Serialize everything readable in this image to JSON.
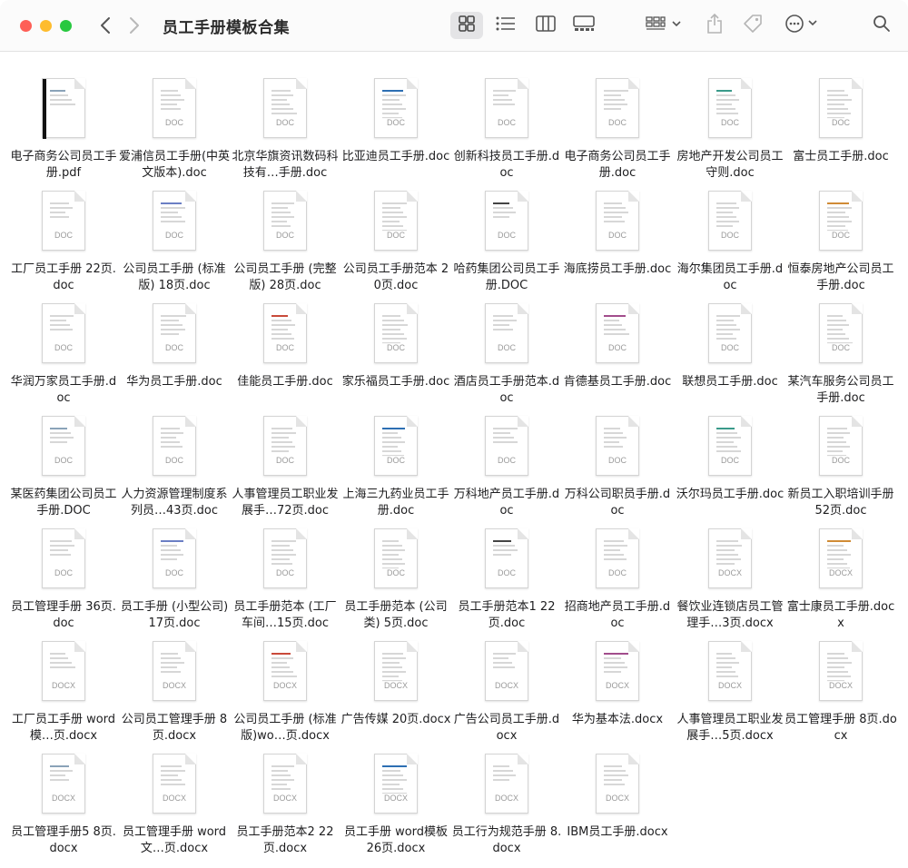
{
  "window": {
    "title": "员工手册模板合集"
  },
  "toolbar": {
    "back_icon": "chevron-left-icon",
    "forward_icon": "chevron-right-icon",
    "view_icons": "icon-grid, list, columns, gallery",
    "group_icon": "group-by-icon",
    "share_icon": "share-icon",
    "tag_icon": "tag-icon",
    "more_icon": "ellipsis-circle-icon",
    "search_icon": "search-icon"
  },
  "files": [
    {
      "name": "电子商务公司员工手册.pdf",
      "type": "pdf",
      "label": ""
    },
    {
      "name": "爱浦信员工手册(中英文版本).doc",
      "type": "doc",
      "label": "DOC"
    },
    {
      "name": "北京华旗资讯数码科技有…手册.doc",
      "type": "doc",
      "label": "DOC"
    },
    {
      "name": "比亚迪员工手册.doc",
      "type": "doc",
      "label": "DOC"
    },
    {
      "name": "创新科技员工手册.doc",
      "type": "doc",
      "label": "DOC"
    },
    {
      "name": "电子商务公司员工手册.doc",
      "type": "doc",
      "label": "DOC"
    },
    {
      "name": "房地产开发公司员工守则.doc",
      "type": "doc",
      "label": "DOC"
    },
    {
      "name": "富士员工手册.doc",
      "type": "doc",
      "label": "DOC"
    },
    {
      "name": "工厂员工手册 22页.doc",
      "type": "doc",
      "label": "DOC"
    },
    {
      "name": "公司员工手册 (标准版) 18页.doc",
      "type": "doc",
      "label": "DOC"
    },
    {
      "name": "公司员工手册 (完整版) 28页.doc",
      "type": "doc",
      "label": "DOC"
    },
    {
      "name": "公司员工手册范本 20页.doc",
      "type": "doc",
      "label": "DOC"
    },
    {
      "name": "哈药集团公司员工手册.DOC",
      "type": "doc",
      "label": "DOC"
    },
    {
      "name": "海底捞员工手册.doc",
      "type": "doc",
      "label": "DOC"
    },
    {
      "name": "海尔集团员工手册.doc",
      "type": "doc",
      "label": "DOC"
    },
    {
      "name": "恒泰房地产公司员工手册.doc",
      "type": "doc",
      "label": "DOC"
    },
    {
      "name": "华润万家员工手册.doc",
      "type": "doc",
      "label": "DOC"
    },
    {
      "name": "华为员工手册.doc",
      "type": "doc",
      "label": "DOC"
    },
    {
      "name": "佳能员工手册.doc",
      "type": "doc",
      "label": "DOC"
    },
    {
      "name": "家乐福员工手册.doc",
      "type": "doc",
      "label": "DOC"
    },
    {
      "name": "酒店员工手册范本.doc",
      "type": "doc",
      "label": "DOC"
    },
    {
      "name": "肯德基员工手册.doc",
      "type": "doc",
      "label": "DOC"
    },
    {
      "name": "联想员工手册.doc",
      "type": "doc",
      "label": "DOC"
    },
    {
      "name": "某汽车服务公司员工手册.doc",
      "type": "doc",
      "label": "DOC"
    },
    {
      "name": "某医药集团公司员工手册.DOC",
      "type": "doc",
      "label": "DOC"
    },
    {
      "name": "人力资源管理制度系列员…43页.doc",
      "type": "doc",
      "label": "DOC"
    },
    {
      "name": "人事管理员工职业发展手…72页.doc",
      "type": "doc",
      "label": "DOC"
    },
    {
      "name": "上海三九药业员工手册.doc",
      "type": "doc",
      "label": "DOC"
    },
    {
      "name": "万科地产员工手册.doc",
      "type": "doc",
      "label": "DOC"
    },
    {
      "name": "万科公司职员手册.doc",
      "type": "doc",
      "label": "DOC"
    },
    {
      "name": "沃尔玛员工手册.doc",
      "type": "doc",
      "label": "DOC"
    },
    {
      "name": "新员工入职培训手册 52页.doc",
      "type": "doc",
      "label": "DOC"
    },
    {
      "name": "员工管理手册  36页.doc",
      "type": "doc",
      "label": "DOC"
    },
    {
      "name": "员工手册 (小型公司) 17页.doc",
      "type": "doc",
      "label": "DOC"
    },
    {
      "name": "员工手册范本 (工厂车间…15页.doc",
      "type": "doc",
      "label": "DOC"
    },
    {
      "name": "员工手册范本 (公司类) 5页.doc",
      "type": "doc",
      "label": "DOC"
    },
    {
      "name": "员工手册范本1 22页.doc",
      "type": "doc",
      "label": "DOC"
    },
    {
      "name": "招商地产员工手册.doc",
      "type": "doc",
      "label": "DOC"
    },
    {
      "name": "餐饮业连锁店员工管理手…3页.docx",
      "type": "docx",
      "label": "DOCX"
    },
    {
      "name": "富士康员工手册.docx",
      "type": "docx",
      "label": "DOCX"
    },
    {
      "name": "工厂员工手册 word模…页.docx",
      "type": "docx",
      "label": "DOCX"
    },
    {
      "name": "公司员工管理手册 8页.docx",
      "type": "docx",
      "label": "DOCX"
    },
    {
      "name": "公司员工手册 (标准版)wo…页.docx",
      "type": "docx",
      "label": "DOCX"
    },
    {
      "name": "广告传媒 20页.docx",
      "type": "docx",
      "label": "DOCX"
    },
    {
      "name": "广告公司员工手册.docx",
      "type": "docx",
      "label": "DOCX"
    },
    {
      "name": "华为基本法.docx",
      "type": "docx",
      "label": "DOCX"
    },
    {
      "name": "人事管理员工职业发展手…5页.docx",
      "type": "docx",
      "label": "DOCX"
    },
    {
      "name": "员工管理手册 8页.docx",
      "type": "docx",
      "label": "DOCX"
    },
    {
      "name": "员工管理手册5 8页.docx",
      "type": "docx",
      "label": "DOCX"
    },
    {
      "name": "员工管理手册 word文…页.docx",
      "type": "docx",
      "label": "DOCX"
    },
    {
      "name": "员工手册范本2 22页.docx",
      "type": "docx",
      "label": "DOCX"
    },
    {
      "name": "员工手册 word模板 26页.docx",
      "type": "docx",
      "label": "DOCX"
    },
    {
      "name": "员工行为规范手册 8.docx",
      "type": "docx",
      "label": "DOCX"
    },
    {
      "name": "IBM员工手册.docx",
      "type": "docx",
      "label": "DOCX"
    }
  ]
}
